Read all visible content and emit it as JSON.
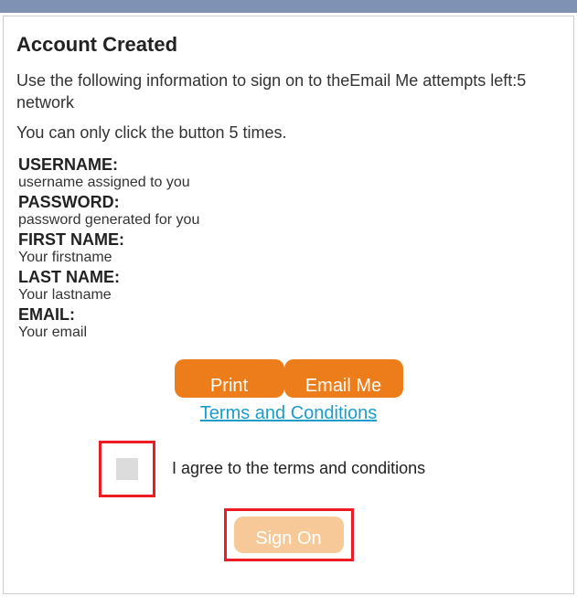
{
  "title": "Account Created",
  "intro_prefix": "Use the following information to sign on to the",
  "intro_button_ref": "Email Me",
  "intro_attempts": " attempts left:5",
  "intro_suffix": " network",
  "subintro": "You can only click the button 5 times.",
  "fields": {
    "username": {
      "label": "USERNAME:",
      "value": "username assigned to you"
    },
    "password": {
      "label": "PASSWORD:",
      "value": "password generated for you"
    },
    "firstname": {
      "label": "FIRST NAME:",
      "value": "Your firstname"
    },
    "lastname": {
      "label": "LAST NAME:",
      "value": "Your lastname"
    },
    "email": {
      "label": "EMAIL:",
      "value": "Your email"
    }
  },
  "buttons": {
    "print": "Print",
    "email": "Email Me",
    "signon": "Sign On"
  },
  "links": {
    "terms": "Terms and Conditions"
  },
  "agree_text": "I agree to the terms and conditions"
}
